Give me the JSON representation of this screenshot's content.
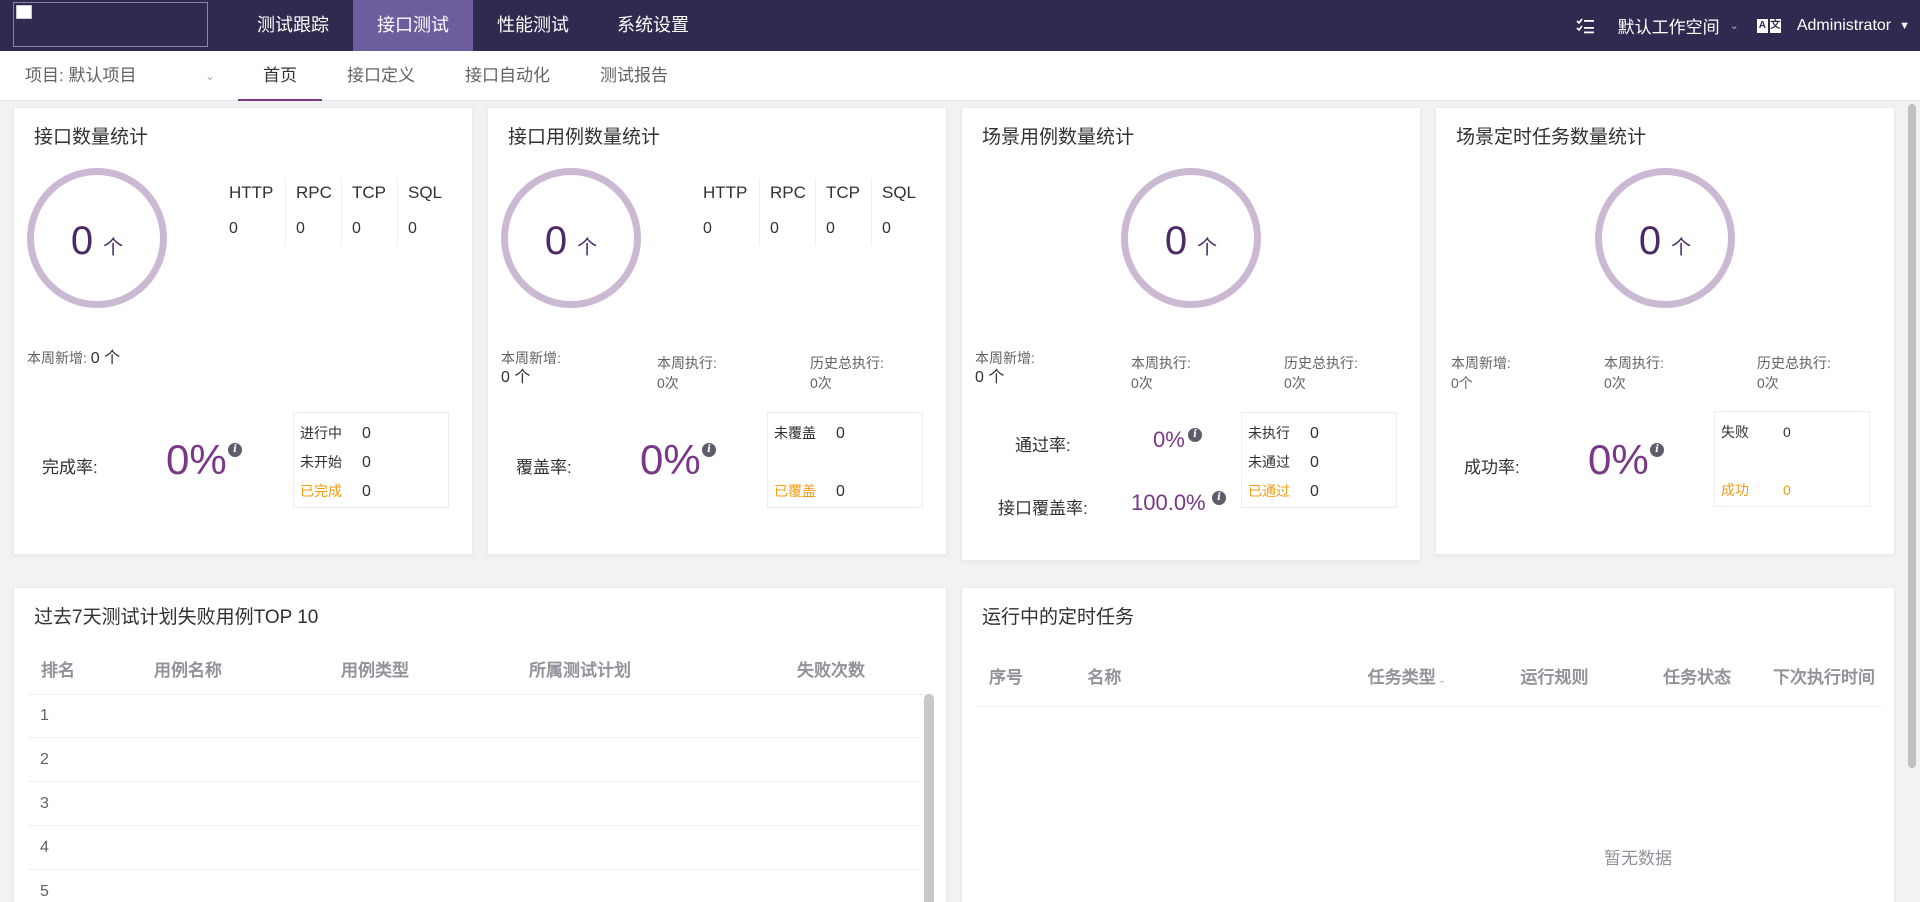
{
  "topnav": {
    "items": [
      "测试跟踪",
      "接口测试",
      "性能测试",
      "系统设置"
    ],
    "active": 1,
    "workspace": "默认工作空间",
    "lang_icon": [
      "A",
      "文"
    ],
    "user": "Administrator"
  },
  "subnav": {
    "project": "项目: 默认项目",
    "items": [
      "首页",
      "接口定义",
      "接口自动化",
      "测试报告"
    ],
    "active": 0
  },
  "cards": {
    "api_count": {
      "title": "接口数量统计",
      "count": "0",
      "unit": "个",
      "protocols": [
        {
          "name": "HTTP",
          "value": "0"
        },
        {
          "name": "RPC",
          "value": "0"
        },
        {
          "name": "TCP",
          "value": "0"
        },
        {
          "name": "SQL",
          "value": "0"
        }
      ],
      "week_new_label": "本周新增:",
      "week_new_value": "0 个",
      "rate_label": "完成率:",
      "rate_value": "0%",
      "status": [
        {
          "label": "进行中",
          "value": "0"
        },
        {
          "label": "未开始",
          "value": "0"
        },
        {
          "label": "已完成",
          "value": "0"
        }
      ]
    },
    "api_case_count": {
      "title": "接口用例数量统计",
      "count": "0",
      "unit": "个",
      "protocols": [
        {
          "name": "HTTP",
          "value": "0"
        },
        {
          "name": "RPC",
          "value": "0"
        },
        {
          "name": "TCP",
          "value": "0"
        },
        {
          "name": "SQL",
          "value": "0"
        }
      ],
      "week_new_label": "本周新增:",
      "week_new_value": "0 个",
      "week_exec_label": "本周执行:",
      "week_exec_value": "0次",
      "total_exec_label": "历史总执行:",
      "total_exec_value": "0次",
      "rate_label": "覆盖率:",
      "rate_value": "0%",
      "status": [
        {
          "label": "未覆盖",
          "value": "0"
        },
        {
          "label": "已覆盖",
          "value": "0"
        }
      ]
    },
    "scenario_count": {
      "title": "场景用例数量统计",
      "count": "0",
      "unit": "个",
      "week_new_label": "本周新增:",
      "week_new_value": "0 个",
      "week_exec_label": "本周执行:",
      "week_exec_value": "0次",
      "total_exec_label": "历史总执行:",
      "total_exec_value": "0次",
      "pass_rate_label": "通过率:",
      "pass_rate_value": "0%",
      "coverage_label": "接口覆盖率:",
      "coverage_value": "100.0%",
      "status": [
        {
          "label": "未执行",
          "value": "0"
        },
        {
          "label": "未通过",
          "value": "0"
        },
        {
          "label": "已通过",
          "value": "0"
        }
      ]
    },
    "schedule_count": {
      "title": "场景定时任务数量统计",
      "count": "0",
      "unit": "个",
      "week_new_label": "本周新增:",
      "week_new_value": "0个",
      "week_exec_label": "本周执行:",
      "week_exec_value": "0次",
      "total_exec_label": "历史总执行:",
      "total_exec_value": "0次",
      "rate_label": "成功率:",
      "rate_value": "0%",
      "status": [
        {
          "label": "失败",
          "value": "0"
        },
        {
          "label": "成功",
          "value": "0"
        }
      ]
    }
  },
  "failure_table": {
    "title": "过去7天测试计划失败用例TOP 10",
    "columns": [
      "排名",
      "用例名称",
      "用例类型",
      "所属测试计划",
      "失败次数"
    ],
    "rows": [
      "1",
      "2",
      "3",
      "4",
      "5"
    ]
  },
  "schedule_table": {
    "title": "运行中的定时任务",
    "columns": [
      "序号",
      "名称",
      "任务类型",
      "运行规则",
      "任务状态",
      "下次执行时间"
    ],
    "empty_text": "暂无数据"
  },
  "colors": {
    "topbar": "#2f2a4f",
    "active_nav": "#6d5c9e",
    "accent": "#783887",
    "ring": "#cbb9d4",
    "orange": "#f39c12"
  }
}
